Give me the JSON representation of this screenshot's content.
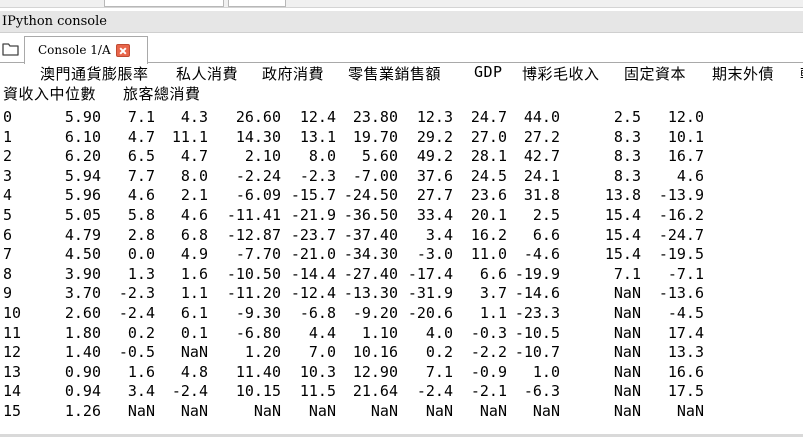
{
  "pane": {
    "title": "IPython console"
  },
  "tabs": [
    {
      "label": "Console 1/A"
    }
  ],
  "icons": {
    "folder": "folder-icon",
    "close": "close-icon"
  },
  "colors": {
    "close_tab": "#e8654a",
    "title_bg": "#e6e6e6"
  },
  "table": {
    "columns_line1": [
      "澳門通貨膨脹率",
      "私人消費",
      "政府消費",
      "零售業銷售額",
      "GDP",
      "博彩毛收入",
      "固定資本",
      "期末外債",
      "輸"
    ],
    "columns_line2": [
      "資收入中位數",
      "旅客總消費"
    ],
    "rows": [
      [
        "0",
        "5.90",
        "7.1",
        "4.3",
        "26.60",
        "12.4",
        "23.80",
        "12.3",
        "24.7",
        "44.0",
        "2.5",
        "12.0"
      ],
      [
        "1",
        "6.10",
        "4.7",
        "11.1",
        "14.30",
        "13.1",
        "19.70",
        "29.2",
        "27.0",
        "27.2",
        "8.3",
        "10.1"
      ],
      [
        "2",
        "6.20",
        "6.5",
        "4.7",
        "2.10",
        "8.0",
        "5.60",
        "49.2",
        "28.1",
        "42.7",
        "8.3",
        "16.7"
      ],
      [
        "3",
        "5.94",
        "7.7",
        "8.0",
        "-2.24",
        "-2.3",
        "-7.00",
        "37.6",
        "24.5",
        "24.1",
        "8.3",
        "4.6"
      ],
      [
        "4",
        "5.96",
        "4.6",
        "2.1",
        "-6.09",
        "-15.7",
        "-24.50",
        "27.7",
        "23.6",
        "31.8",
        "13.8",
        "-13.9"
      ],
      [
        "5",
        "5.05",
        "5.8",
        "4.6",
        "-11.41",
        "-21.9",
        "-36.50",
        "33.4",
        "20.1",
        "2.5",
        "15.4",
        "-16.2"
      ],
      [
        "6",
        "4.79",
        "2.8",
        "6.8",
        "-12.87",
        "-23.7",
        "-37.40",
        "3.4",
        "16.2",
        "6.6",
        "15.4",
        "-24.7"
      ],
      [
        "7",
        "4.50",
        "0.0",
        "4.9",
        "-7.70",
        "-21.0",
        "-34.30",
        "-3.0",
        "11.0",
        "-4.6",
        "15.4",
        "-19.5"
      ],
      [
        "8",
        "3.90",
        "1.3",
        "1.6",
        "-10.50",
        "-14.4",
        "-27.40",
        "-17.4",
        "6.6",
        "-19.9",
        "7.1",
        "-7.1"
      ],
      [
        "9",
        "3.70",
        "-2.3",
        "1.1",
        "-11.20",
        "-12.4",
        "-13.30",
        "-31.9",
        "3.7",
        "-14.6",
        "NaN",
        "-13.6"
      ],
      [
        "10",
        "2.60",
        "-2.4",
        "6.1",
        "-9.30",
        "-6.8",
        "-9.20",
        "-20.6",
        "1.1",
        "-23.3",
        "NaN",
        "-4.5"
      ],
      [
        "11",
        "1.80",
        "0.2",
        "0.1",
        "-6.80",
        "4.4",
        "1.10",
        "4.0",
        "-0.3",
        "-10.5",
        "NaN",
        "17.4"
      ],
      [
        "12",
        "1.40",
        "-0.5",
        "NaN",
        "1.20",
        "7.0",
        "10.16",
        "0.2",
        "-2.2",
        "-10.7",
        "NaN",
        "13.3"
      ],
      [
        "13",
        "0.90",
        "1.6",
        "4.8",
        "11.40",
        "10.3",
        "12.90",
        "7.1",
        "-0.9",
        "1.0",
        "NaN",
        "16.6"
      ],
      [
        "14",
        "0.94",
        "3.4",
        "-2.4",
        "10.15",
        "11.5",
        "21.64",
        "-2.4",
        "-2.1",
        "-6.3",
        "NaN",
        "17.5"
      ],
      [
        "15",
        "1.26",
        "NaN",
        "NaN",
        "NaN",
        "NaN",
        "NaN",
        "NaN",
        "NaN",
        "NaN",
        "NaN",
        "NaN"
      ]
    ]
  }
}
